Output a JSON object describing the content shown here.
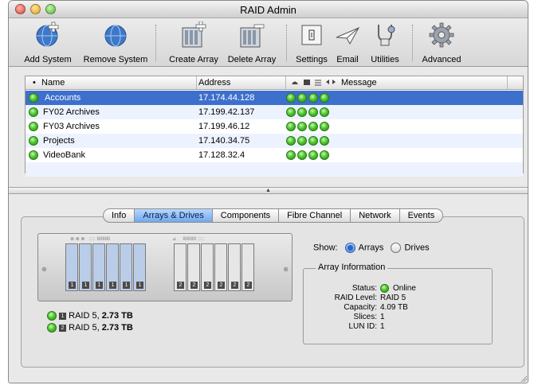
{
  "window": {
    "title": "RAID Admin"
  },
  "toolbar": {
    "items": [
      {
        "label": "Add System",
        "icon": "globe-plus-icon"
      },
      {
        "label": "Remove System",
        "icon": "globe-icon"
      },
      {
        "label": "Create Array",
        "icon": "drive-bays-plus-icon"
      },
      {
        "label": "Delete Array",
        "icon": "drive-bays-minus-icon"
      },
      {
        "label": "Settings",
        "icon": "settings-panel-icon"
      },
      {
        "label": "Email",
        "icon": "paper-plane-icon"
      },
      {
        "label": "Utilities",
        "icon": "stethoscope-icon"
      },
      {
        "label": "Advanced",
        "icon": "gear-icon"
      }
    ]
  },
  "table": {
    "headers": {
      "name": "Name",
      "address": "Address",
      "message": "Message"
    },
    "rows": [
      {
        "name": "Accounts",
        "address": "17.174.44.128",
        "status": "online",
        "selected": true
      },
      {
        "name": "FY02 Archives",
        "address": "17.199.42.137",
        "status": "online",
        "selected": false
      },
      {
        "name": "FY03 Archives",
        "address": "17.199.46.12",
        "status": "online",
        "selected": false
      },
      {
        "name": "Projects",
        "address": "17.140.34.75",
        "status": "online",
        "selected": false
      },
      {
        "name": "VideoBank",
        "address": "17.128.32.4",
        "status": "online",
        "selected": false
      }
    ]
  },
  "tabs": [
    "Info",
    "Arrays & Drives",
    "Components",
    "Fibre Channel",
    "Network",
    "Events"
  ],
  "active_tab": "Arrays & Drives",
  "arrays": [
    {
      "num": "1",
      "label": "RAID 5,",
      "size": "2.73 TB"
    },
    {
      "num": "2",
      "label": "RAID 5,",
      "size": "2.73 TB"
    }
  ],
  "show": {
    "label": "Show:",
    "options": [
      "Arrays",
      "Drives"
    ],
    "selected": "Arrays"
  },
  "array_info": {
    "title": "Array Information",
    "fields": [
      {
        "key": "Status:",
        "value": "Online"
      },
      {
        "key": "RAID Level:",
        "value": "RAID 5"
      },
      {
        "key": "Capacity:",
        "value": "4.09 TB"
      },
      {
        "key": "Slices:",
        "value": "1"
      },
      {
        "key": "LUN ID:",
        "value": "1"
      }
    ]
  },
  "colors": {
    "selection": "#3d6fcc",
    "status_green": "#50c82e",
    "array1_bay": "#b9cde8",
    "array2_bay": "#e6e6e6",
    "tab_active": "#6fa7ee"
  }
}
